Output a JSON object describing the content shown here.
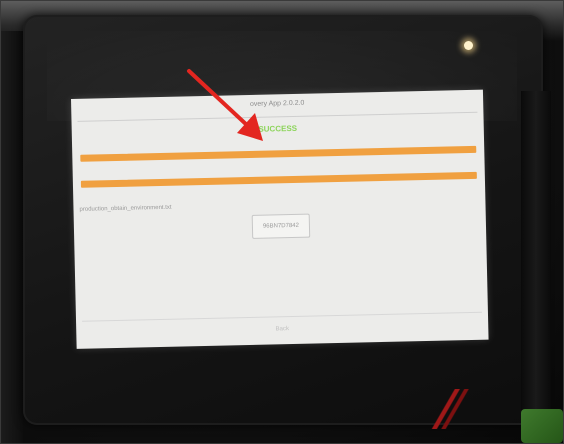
{
  "screen": {
    "app_title": "overy App 2.0.2.0",
    "status": "SUCCESS",
    "status_detail": "",
    "file_name": "production_obtain_environment.txt",
    "serial_value": "96BN7D7842",
    "back_label": "Back"
  },
  "progress": {
    "bar_1_fraction": 1.0,
    "bar_2_fraction": 1.0
  },
  "colors": {
    "status_green": "#8cd45a",
    "progress_orange": "#f0a040",
    "annotation_red": "#e32620",
    "screen_bg": "#ececea"
  },
  "annotation": {
    "icon": "red-arrow-icon"
  }
}
